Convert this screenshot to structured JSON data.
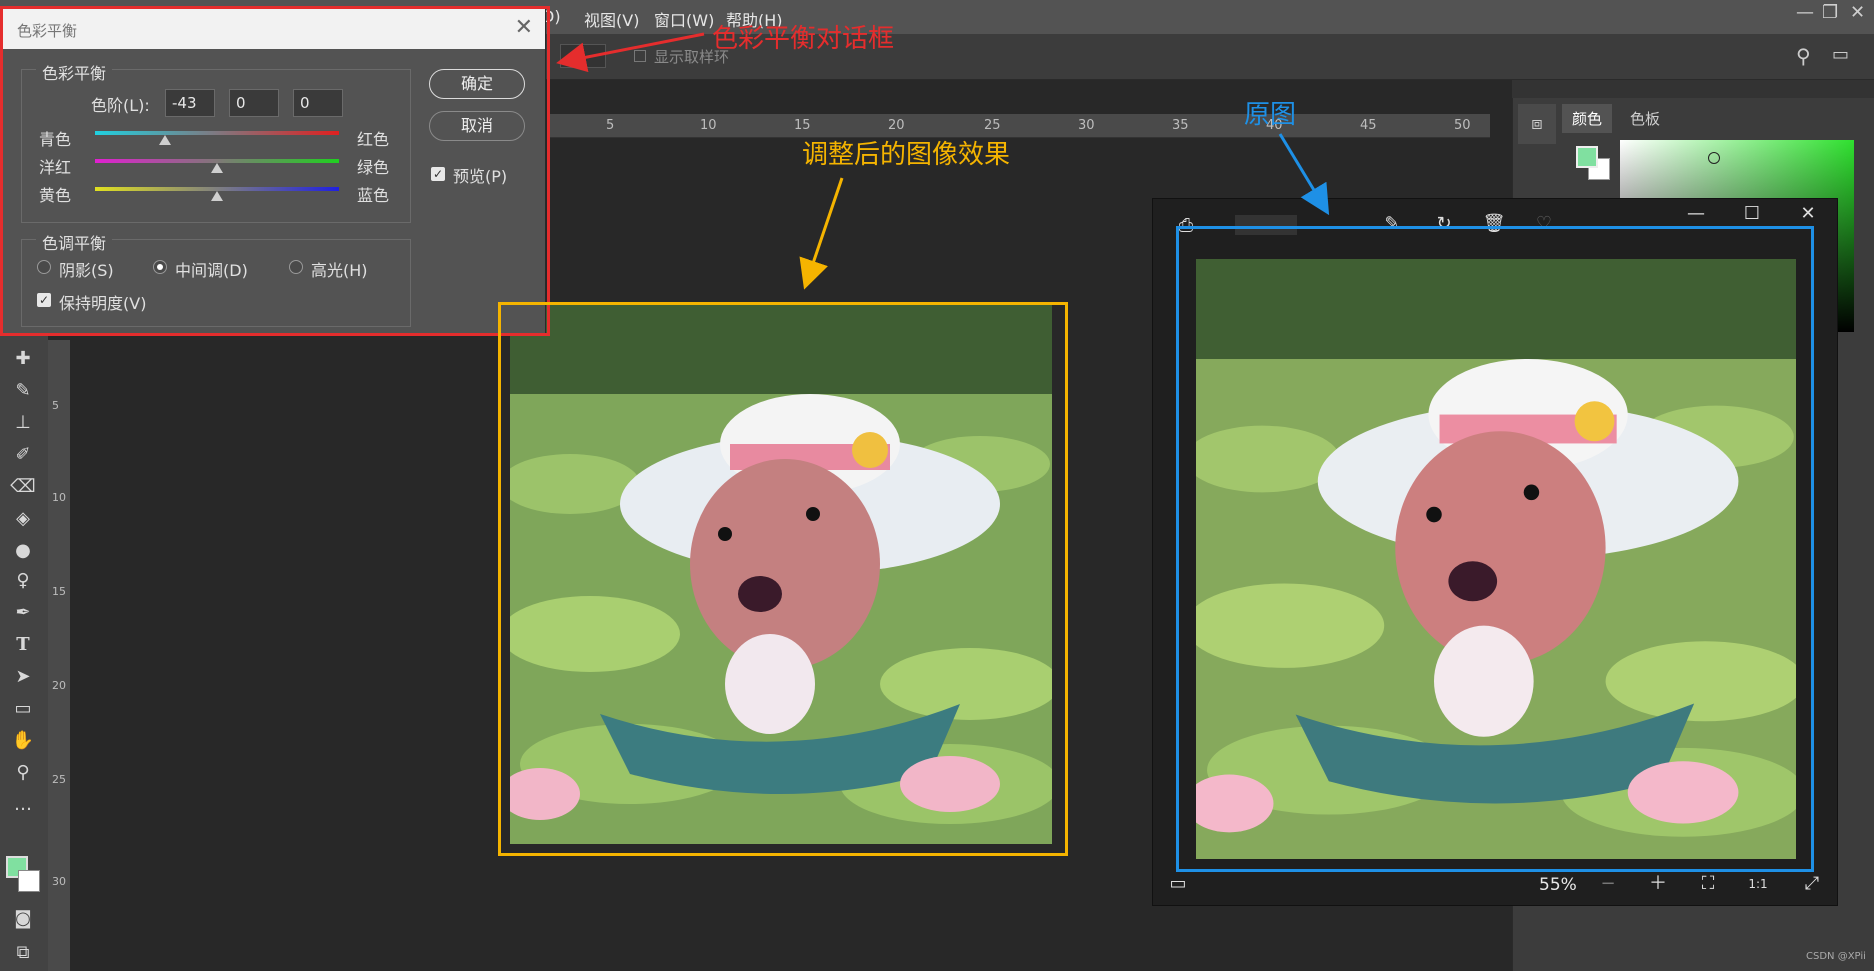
{
  "menubar": {
    "items": [
      "D)",
      "视图(V)",
      "窗口(W)",
      "帮助(H)"
    ],
    "window_controls": [
      "—",
      "❐",
      "✕"
    ]
  },
  "options": {
    "sample_ring": "显示取样环"
  },
  "ruler_top": [
    "5",
    "10",
    "15",
    "20",
    "25",
    "30",
    "35",
    "40",
    "45",
    "50"
  ],
  "ruler_left": [
    "5",
    "10",
    "15",
    "20",
    "25",
    "30"
  ],
  "dialog": {
    "title": "色彩平衡",
    "close": "✕",
    "group_color": "色彩平衡",
    "levels_label": "色阶(L):",
    "levels": [
      "-43",
      "0",
      "0"
    ],
    "sliders": [
      {
        "left": "青色",
        "right": "红色",
        "value": -43
      },
      {
        "left": "洋红",
        "right": "绿色",
        "value": 0
      },
      {
        "left": "黄色",
        "right": "蓝色",
        "value": 0
      }
    ],
    "ok": "确定",
    "cancel": "取消",
    "preview": "预览(P)",
    "group_tone": "色调平衡",
    "tones": [
      "阴影(S)",
      "中间调(D)",
      "高光(H)"
    ],
    "tone_selected": "中间调(D)",
    "preserve": "保持明度(V)"
  },
  "annotations": {
    "dialog_label": "色彩平衡对话框",
    "adjusted_label": "调整后的图像效果",
    "original_label": "原图",
    "colors": {
      "red": "#e52d2d",
      "yellow": "#f5b400",
      "blue": "#1e90e6"
    }
  },
  "right_panel": {
    "tab_color": "颜色",
    "tab_swatches": "色板"
  },
  "viewer": {
    "zoom": "55%",
    "controls": [
      "▭",
      "−",
      "＋",
      "⛶",
      "1:1",
      "⤢"
    ],
    "titlebar": [
      "—",
      "☐",
      "✕"
    ]
  },
  "watermark": "CSDN @XPii"
}
